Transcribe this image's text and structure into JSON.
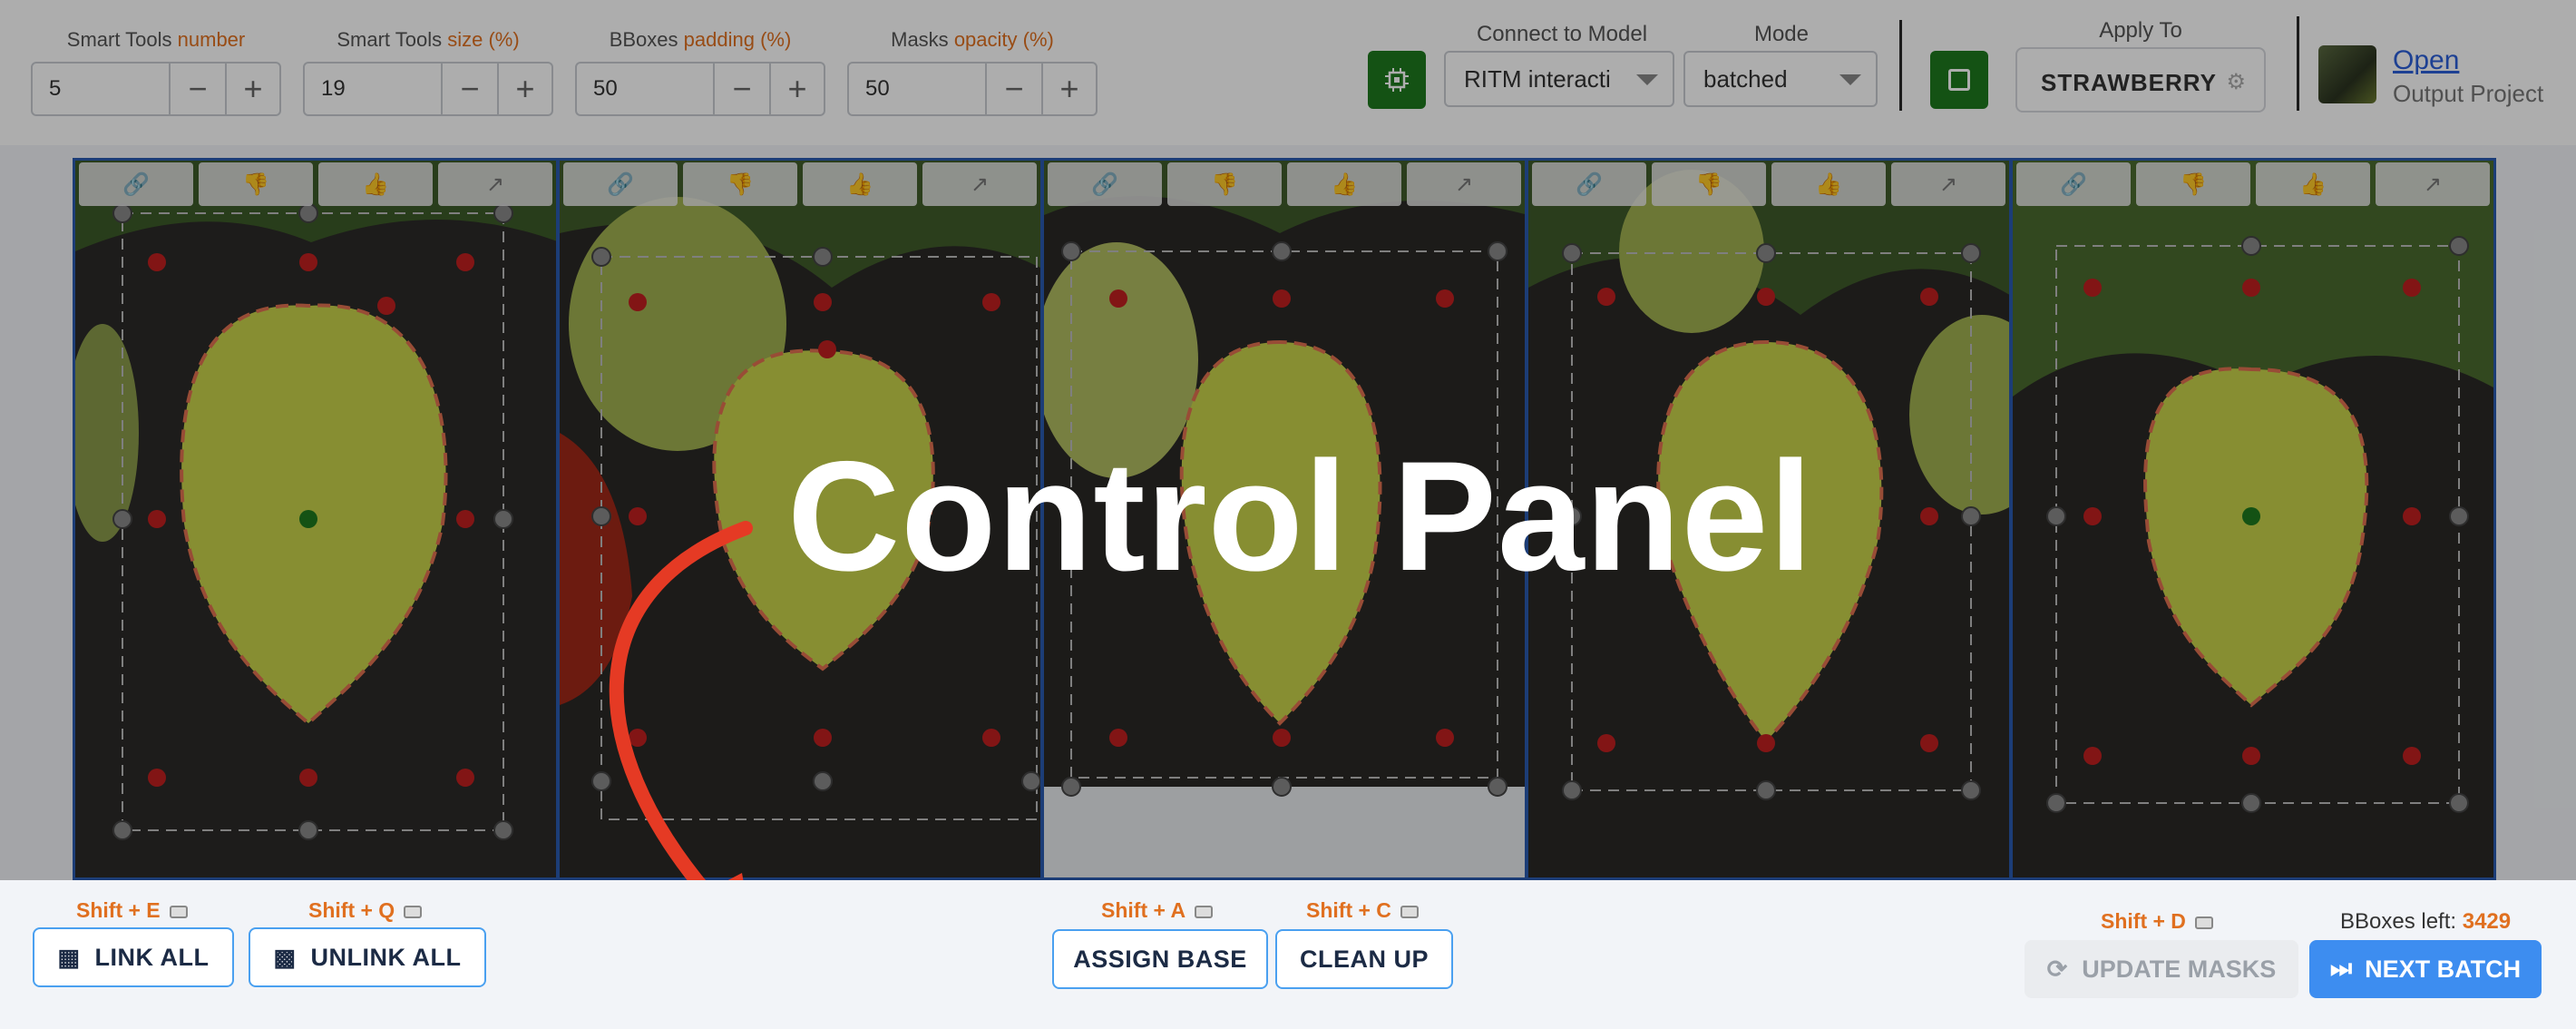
{
  "toolbar": {
    "steppers": [
      {
        "label": "Smart Tools",
        "highlight": "number",
        "value": "5"
      },
      {
        "label": "Smart Tools",
        "highlight": "size (%)",
        "value": "19"
      },
      {
        "label": "BBoxes",
        "highlight": "padding (%)",
        "value": "50"
      },
      {
        "label": "Masks",
        "highlight": "opacity (%)",
        "value": "50"
      }
    ],
    "minus": "−",
    "plus": "+",
    "connect_label": "Connect to Model",
    "model_value": "RITM interacti",
    "mode_label": "Mode",
    "mode_value": "batched",
    "apply_to_label": "Apply To",
    "apply_to_class": "STRAWBERRY",
    "open_link": "Open",
    "output_project": "Output Project"
  },
  "panel_tools": [
    "link-icon",
    "thumbs-down-icon",
    "thumbs-up-icon",
    "expand-arrow-icon"
  ],
  "overlay": {
    "title": "Control Panel"
  },
  "control_panel": {
    "link_hint": "Shift + E",
    "link_all": "LINK ALL",
    "unlink_hint": "Shift + Q",
    "unlink_all": "UNLINK ALL",
    "assign_hint": "Shift + A",
    "assign_base": "ASSIGN BASE",
    "clean_hint": "Shift + C",
    "clean_up": "CLEAN UP",
    "update_hint": "Shift + D",
    "update_masks": "UPDATE MASKS",
    "next_batch": "NEXT BATCH",
    "bboxes_left_label": "BBoxes left:",
    "bboxes_left_value": "3429"
  },
  "colors": {
    "accent_orange": "#e07020",
    "primary_blue": "#3d8df0",
    "model_green": "#1e7a1e",
    "mask_yellow": "#c8d24a"
  }
}
